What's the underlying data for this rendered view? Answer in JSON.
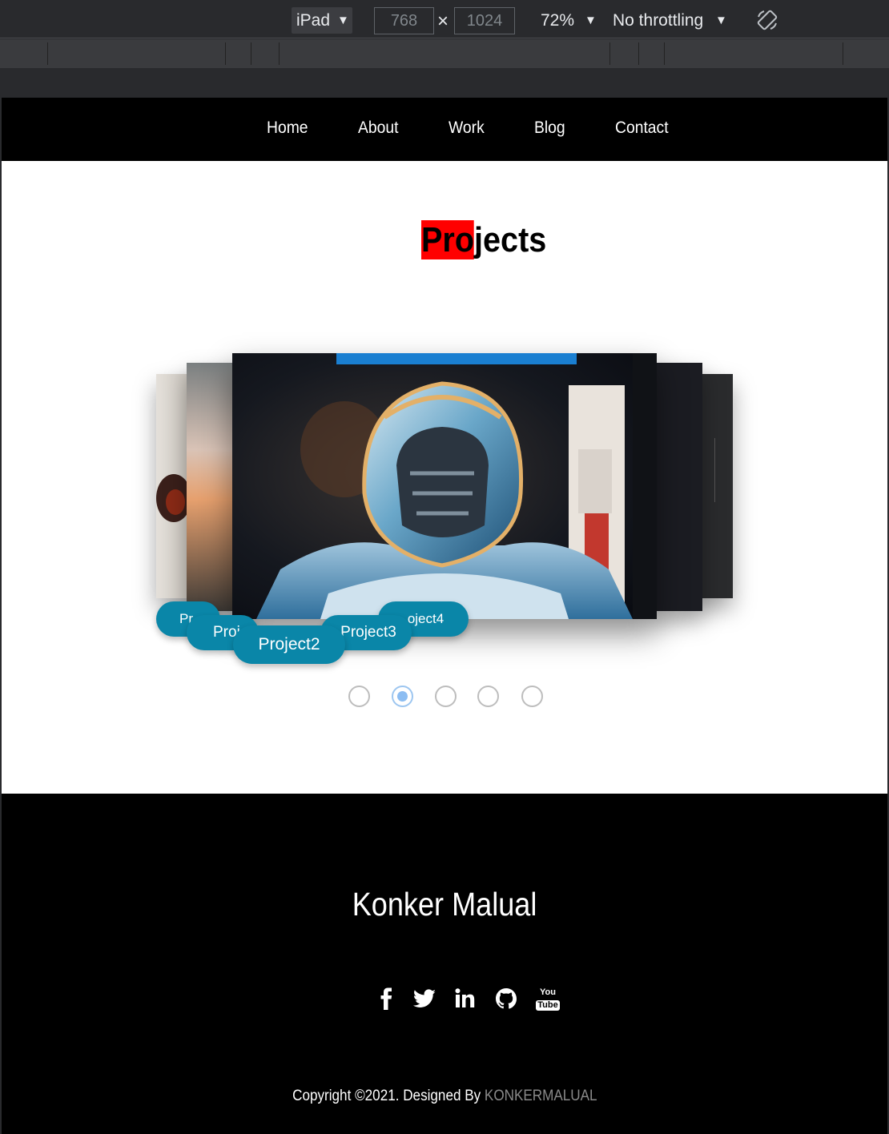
{
  "devtools": {
    "device": "iPad",
    "width": "768",
    "height": "1024",
    "times": "×",
    "zoom": "72%",
    "throttling": "No throttling",
    "caret": "▼"
  },
  "nav": {
    "items": [
      "Home",
      "About",
      "Work",
      "Blog",
      "Contact"
    ]
  },
  "projects": {
    "title_highlight": "Pro",
    "title_rest": "jects",
    "highlight_color": "#ff0000",
    "cards": [
      "Pr",
      "Proj",
      "Project2",
      "Project3",
      "oject4"
    ],
    "active_index": 1,
    "dot_count": 5
  },
  "footer": {
    "name": "Konker Malual",
    "social_icons": [
      "facebook-icon",
      "twitter-icon",
      "linkedin-icon",
      "github-icon",
      "youtube-icon"
    ],
    "youtube_top": "You",
    "youtube_bottom": "Tube",
    "copyright_text": "Copyright ©2021. Designed By ",
    "copyright_link": "KONKERMALUAL"
  },
  "colors": {
    "nav_bg": "#000000",
    "accent_pill": "#0a86a8",
    "dot_active": "#8cbdf2",
    "link_gray": "#8a8a8a"
  }
}
